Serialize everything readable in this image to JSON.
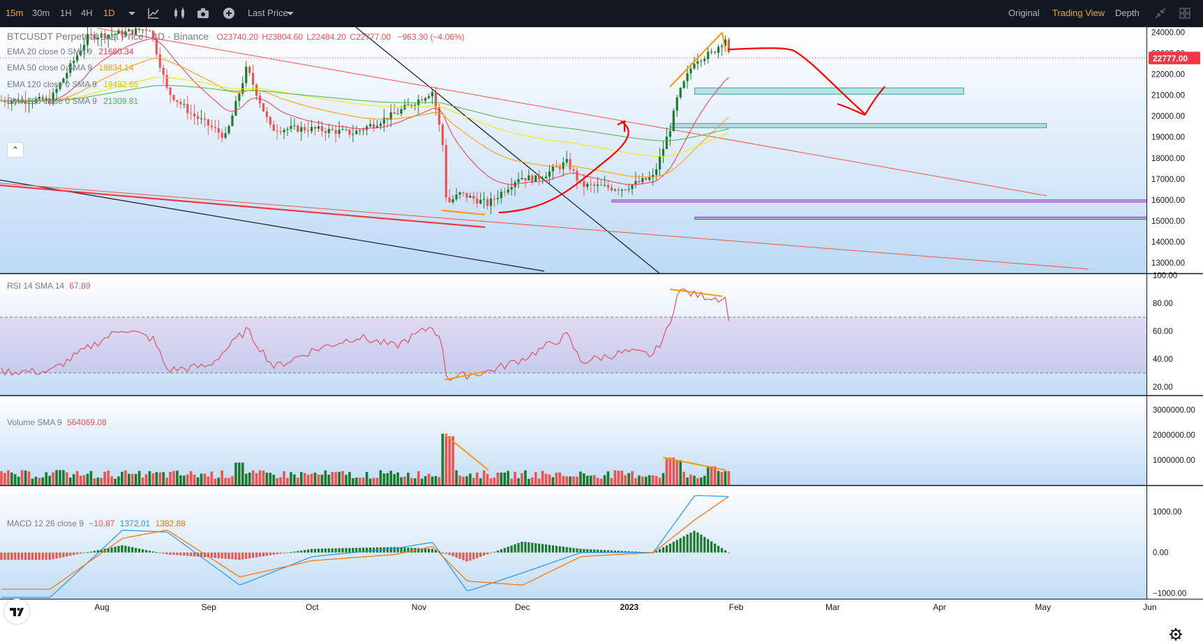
{
  "toolbar": {
    "intervals": [
      {
        "label": "15m",
        "active": true
      },
      {
        "label": "30m",
        "active": false
      },
      {
        "label": "1H",
        "active": false
      },
      {
        "label": "4H",
        "active": false
      },
      {
        "label": "1D",
        "active": true
      }
    ],
    "price_type": "Last Price",
    "views": [
      {
        "label": "Original",
        "active": false
      },
      {
        "label": "Trading View",
        "active": true
      },
      {
        "label": "Depth",
        "active": false
      }
    ],
    "icons": [
      "chevron-down-icon",
      "line-chart-icon",
      "candles-icon",
      "camera-icon",
      "plus-circle-icon",
      "collapse-icon",
      "grid-icon"
    ]
  },
  "legend": {
    "symbol": "BTCUSDT Perpetual Last Price · 1D · Binance",
    "ohlc": {
      "open": "O23740.20",
      "high": "H23804.60",
      "low": "L22484.20",
      "close": "C22777.00",
      "change": "−963.30 (−4.06%)"
    },
    "ema": [
      {
        "label": "EMA 20 close 0 SMA 9",
        "value": "21680.34",
        "color": "#f23645"
      },
      {
        "label": "EMA 50 close 0 SMA 9",
        "value": "19834.14",
        "color": "#ff9800"
      },
      {
        "label": "EMA 120 close 0 SMA 9",
        "value": "19492.65",
        "color": "#f5e600"
      },
      {
        "label": "EMA 200 close 0 SMA 9",
        "value": "21309.81",
        "color": "#4caf50"
      }
    ],
    "rsi": {
      "label": "RSI 14 SMA 14",
      "value": "67.89"
    },
    "volume": {
      "label": "Volume SMA 9",
      "value": "564069.08"
    },
    "macd": {
      "label": "MACD 12 26 close 9",
      "v1": "−10.87",
      "v2": "1372.01",
      "v3": "1382.88"
    }
  },
  "colors": {
    "up": "#26a69a",
    "up_dark": "#1b7a2c",
    "down": "#ef5350",
    "ema20": "#f23645",
    "ema50": "#ff9800",
    "ema120": "#f5e600",
    "ema200": "#4caf50",
    "rsi": "#e05a6a",
    "macd": "#2196f3",
    "signal": "#ff6d00",
    "annotation": "#ff0000",
    "accent": "#f0a830"
  },
  "chart_data": [
    {
      "type": "candlestick",
      "title": "BTCUSDT Perpetual Last Price · 1D · Binance",
      "y_axis": {
        "ticks": [
          "24000.00",
          "23000.00",
          "22000.00",
          "21000.00",
          "20000.00",
          "19000.00",
          "18000.00",
          "17000.00",
          "16000.00",
          "15000.00",
          "14000.00",
          "13000.00"
        ],
        "range": [
          12500,
          24250
        ]
      },
      "x_axis": {
        "ticks": [
          "Aug",
          "Sep",
          "Oct",
          "Nov",
          "Dec",
          "2023",
          "Feb",
          "Mar",
          "Apr",
          "May",
          "Jun"
        ]
      },
      "last_price": "22777.00",
      "close_series": [
        {
          "date": "2022-07-17",
          "close": 20750
        },
        {
          "date": "2022-07-28",
          "close": 23800
        },
        {
          "date": "2022-08-08",
          "close": 24000
        },
        {
          "date": "2022-08-15",
          "close": 24200
        },
        {
          "date": "2022-08-20",
          "close": 21200
        },
        {
          "date": "2022-08-27",
          "close": 20100
        },
        {
          "date": "2022-09-06",
          "close": 19000
        },
        {
          "date": "2022-09-12",
          "close": 22300
        },
        {
          "date": "2022-09-19",
          "close": 19400
        },
        {
          "date": "2022-09-30",
          "close": 19400
        },
        {
          "date": "2022-10-13",
          "close": 19200
        },
        {
          "date": "2022-10-25",
          "close": 20100
        },
        {
          "date": "2022-11-05",
          "close": 21200
        },
        {
          "date": "2022-11-08",
          "close": 18500
        },
        {
          "date": "2022-11-09",
          "close": 15800
        },
        {
          "date": "2022-11-13",
          "close": 16300
        },
        {
          "date": "2022-11-21",
          "close": 15800
        },
        {
          "date": "2022-11-30",
          "close": 17100
        },
        {
          "date": "2022-12-05",
          "close": 17000
        },
        {
          "date": "2022-12-14",
          "close": 17800
        },
        {
          "date": "2022-12-18",
          "close": 16700
        },
        {
          "date": "2022-12-30",
          "close": 16550
        },
        {
          "date": "2023-01-08",
          "close": 17100
        },
        {
          "date": "2023-01-13",
          "close": 19500
        },
        {
          "date": "2023-01-15",
          "close": 20900
        },
        {
          "date": "2023-01-20",
          "close": 22700
        },
        {
          "date": "2023-01-25",
          "close": 23000
        },
        {
          "date": "2023-01-29",
          "close": 23740
        },
        {
          "date": "2023-01-30",
          "close": 22777
        }
      ],
      "horizontal_zones": [
        {
          "from": "2023-01-20",
          "to": "2023-04-08",
          "low": 21050,
          "high": 21350,
          "color": "#26a69a"
        },
        {
          "from": "2023-01-13",
          "to": "2023-05-02",
          "low": 19450,
          "high": 19650,
          "color": "#26a69a"
        },
        {
          "from": "2022-12-27",
          "to": "2023-06-10",
          "low": 15900,
          "high": 16000,
          "color": "#9c27b0"
        },
        {
          "from": "2023-01-20",
          "to": "2023-06-10",
          "low": 15080,
          "high": 15180,
          "color": "#9c27b0"
        }
      ]
    },
    {
      "type": "line",
      "title": "RSI 14 SMA 14",
      "y_axis": {
        "ticks": [
          "100.00",
          "80.00",
          "60.00",
          "40.00",
          "20.00"
        ],
        "range": [
          15,
          100
        ]
      },
      "bands": [
        30,
        70
      ],
      "x": [
        "2022-07-17",
        "2022-07-28",
        "2022-08-07",
        "2022-08-16",
        "2022-08-20",
        "2022-09-01",
        "2022-09-12",
        "2022-09-20",
        "2022-10-01",
        "2022-10-14",
        "2022-10-25",
        "2022-11-05",
        "2022-11-08",
        "2022-11-09",
        "2022-11-21",
        "2022-12-01",
        "2022-12-14",
        "2022-12-18",
        "2022-12-31",
        "2023-01-08",
        "2023-01-13",
        "2023-01-15",
        "2023-01-20",
        "2023-01-29",
        "2023-01-30"
      ],
      "values": [
        31,
        48,
        62,
        54,
        32,
        35,
        61,
        34,
        46,
        56,
        49,
        64,
        48,
        26,
        31,
        40,
        57,
        38,
        45,
        43,
        65,
        90,
        86,
        83,
        67.89
      ]
    },
    {
      "type": "bar",
      "title": "Volume SMA 9",
      "y_axis": {
        "ticks": [
          "3000000.00",
          "2000000.00",
          "1000000.00"
        ],
        "range": [
          0,
          3500000
        ]
      },
      "series": [
        {
          "x": [
            "2022-07-20",
            "2022-08-10",
            "2022-09-10",
            "2022-10-15",
            "2022-11-09",
            "2022-11-10",
            "2022-11-25",
            "2022-12-15",
            "2023-01-13",
            "2023-01-15",
            "2023-01-25",
            "2023-01-30"
          ],
          "values": [
            600000,
            450000,
            900000,
            300000,
            2050000,
            1950000,
            500000,
            350000,
            1100000,
            1000000,
            750000,
            560000
          ]
        }
      ]
    },
    {
      "type": "line",
      "title": "MACD 12 26 close 9",
      "y_axis": {
        "ticks": [
          "1000.00",
          "0.00",
          "−1000.00"
        ],
        "range": [
          -1100,
          1600
        ]
      },
      "x": [
        "2022-07-17",
        "2022-08-07",
        "2022-08-20",
        "2022-09-10",
        "2022-10-01",
        "2022-10-25",
        "2022-11-05",
        "2022-11-15",
        "2022-12-01",
        "2022-12-18",
        "2023-01-08",
        "2023-01-20",
        "2023-01-30"
      ],
      "series": [
        {
          "name": "MACD",
          "values": [
            -1100,
            550,
            500,
            -800,
            -100,
            100,
            250,
            -950,
            -500,
            0,
            0,
            1400,
            1372
          ]
        },
        {
          "name": "Signal",
          "values": [
            -900,
            350,
            550,
            -600,
            -200,
            -50,
            150,
            -700,
            -800,
            -100,
            0,
            800,
            1383
          ]
        }
      ]
    }
  ]
}
